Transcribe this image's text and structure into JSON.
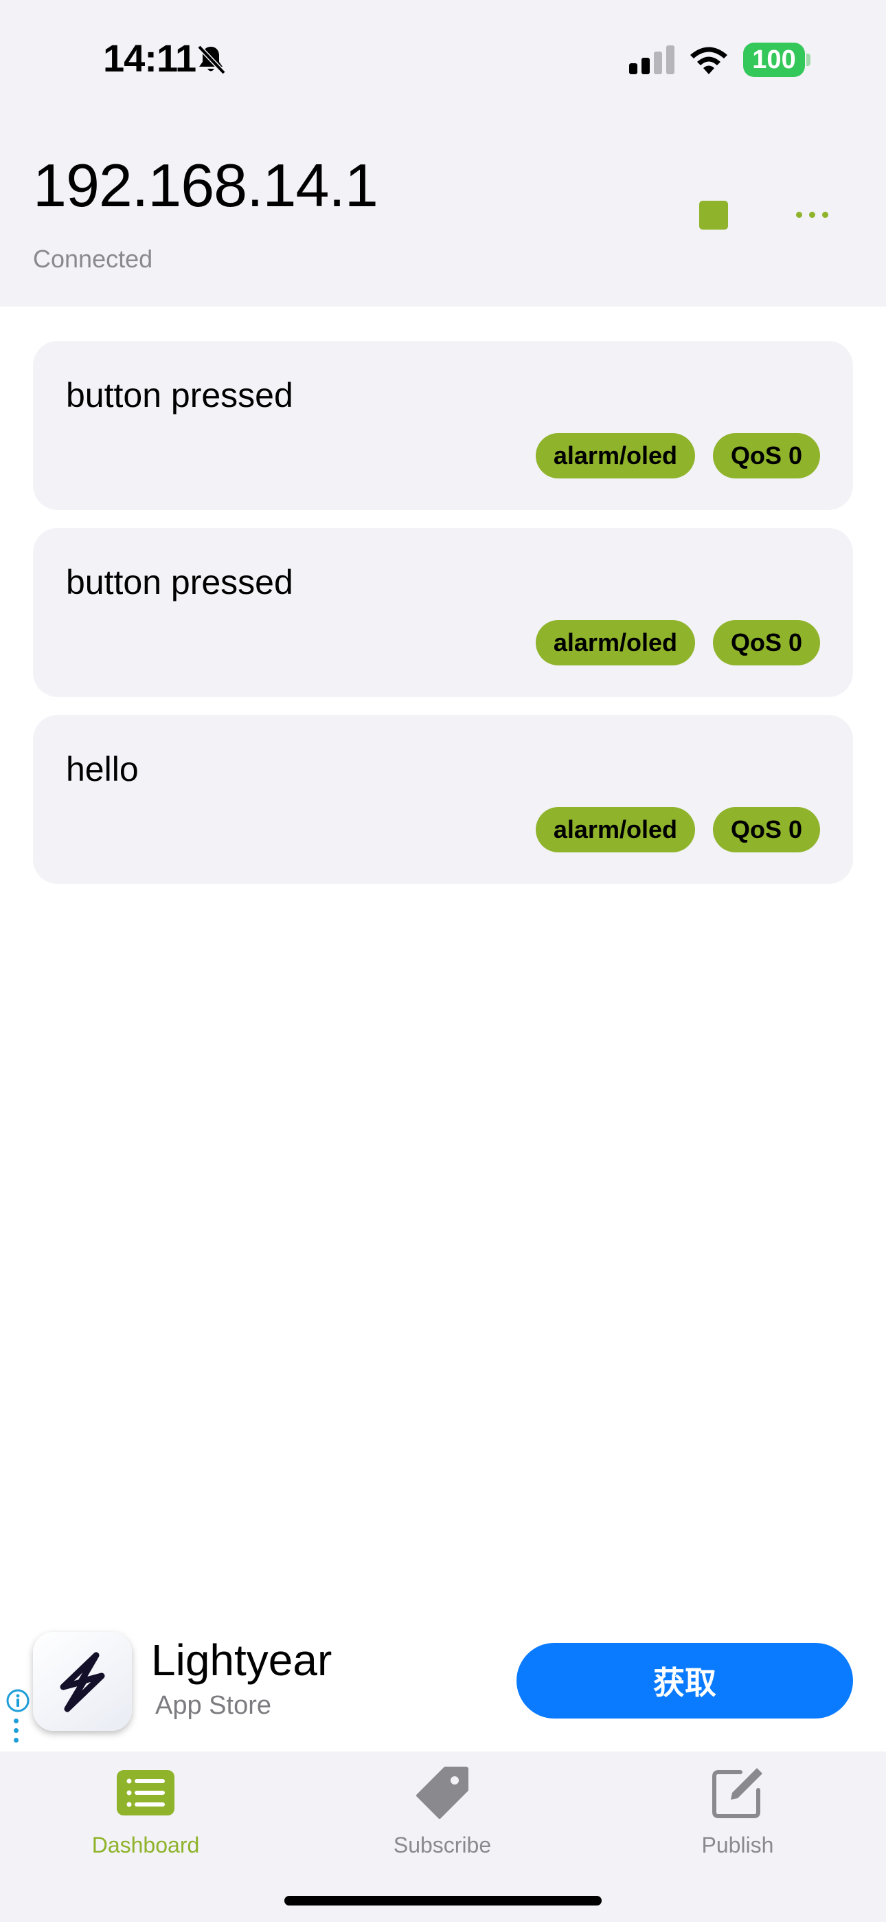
{
  "status_bar": {
    "time": "14:11",
    "battery": "100",
    "icons": [
      "bell-slash-icon",
      "cellular-signal-icon",
      "wifi-icon",
      "battery-icon"
    ],
    "battery_color": "#34c759"
  },
  "header": {
    "title": "192.168.14.1",
    "status": "Connected",
    "actions": [
      "stop-icon",
      "more-icon"
    ],
    "accent_color": "#8fb32a"
  },
  "messages": [
    {
      "text": "button pressed",
      "topic": "alarm/oled",
      "qos": "QoS 0"
    },
    {
      "text": "button pressed",
      "topic": "alarm/oled",
      "qos": "QoS 0"
    },
    {
      "text": "hello",
      "topic": "alarm/oled",
      "qos": "QoS 0"
    }
  ],
  "ad": {
    "app_name": "Lightyear",
    "source": "App Store",
    "button_label": "获取",
    "button_color": "#0a7bff",
    "icons": [
      "info-icon",
      "lightning-bolt-icon"
    ]
  },
  "tab_bar": {
    "tabs": [
      {
        "label": "Dashboard",
        "icon": "list-icon",
        "active": true
      },
      {
        "label": "Subscribe",
        "icon": "tag-icon",
        "active": false
      },
      {
        "label": "Publish",
        "icon": "compose-icon",
        "active": false
      }
    ]
  }
}
